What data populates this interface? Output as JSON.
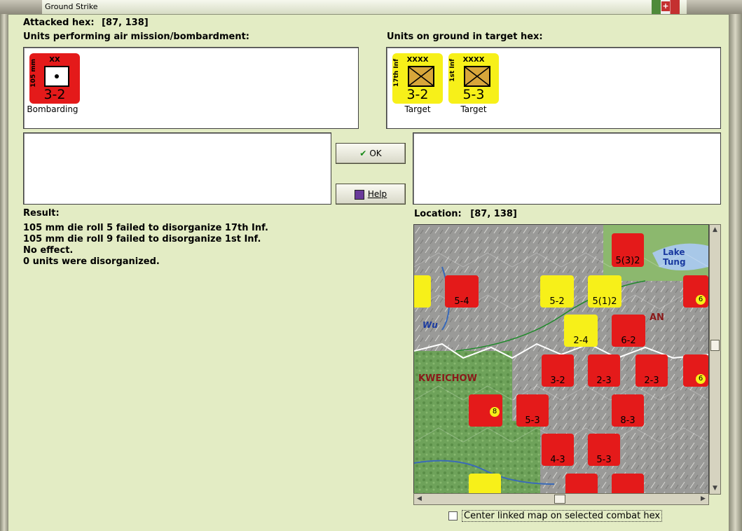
{
  "window": {
    "title": "Ground Strike"
  },
  "attacked_hex": {
    "label": "Attacked hex:",
    "value": "[87, 138]"
  },
  "air_units": {
    "heading": "Units performing air mission/bombardment:",
    "items": [
      {
        "size": "XX",
        "side": "105 mm",
        "value": "3-2",
        "caption": "Bombarding"
      }
    ]
  },
  "ground_units": {
    "heading": "Units on ground in target hex:",
    "items": [
      {
        "size": "XXXX",
        "side": "17th Inf",
        "value": "3-2",
        "caption": "Target"
      },
      {
        "size": "XXXX",
        "side": "1st Inf",
        "value": "5-3",
        "caption": "Target"
      }
    ]
  },
  "buttons": {
    "ok": "OK",
    "help": "Help"
  },
  "result": {
    "heading": "Result:",
    "lines": [
      "105 mm die roll 5 failed to disorganize 17th Inf.",
      "105 mm die roll 9 failed to disorganize 1st Inf.",
      "No effect.",
      "0 units were disorganized."
    ]
  },
  "location": {
    "label": "Location:",
    "value": "[87, 138]"
  },
  "map": {
    "place_labels": [
      "Lake Tung",
      "Wu",
      "KWEICHOW",
      "AN"
    ],
    "unit_values": [
      "5(3)2",
      "5-4",
      "5-2",
      "5(1)2",
      "2-4",
      "6-2",
      "3-2",
      "2-3",
      "2-3",
      "5-3",
      "8-3",
      "4-3",
      "5-3",
      "6",
      "6",
      "8"
    ]
  },
  "center_map_checkbox": {
    "label": "Center linked map on selected combat hex",
    "checked": false
  },
  "colors": {
    "background": "#e3ecc4",
    "counter_red": "#e41a1a",
    "counter_yellow": "#f7f019"
  }
}
